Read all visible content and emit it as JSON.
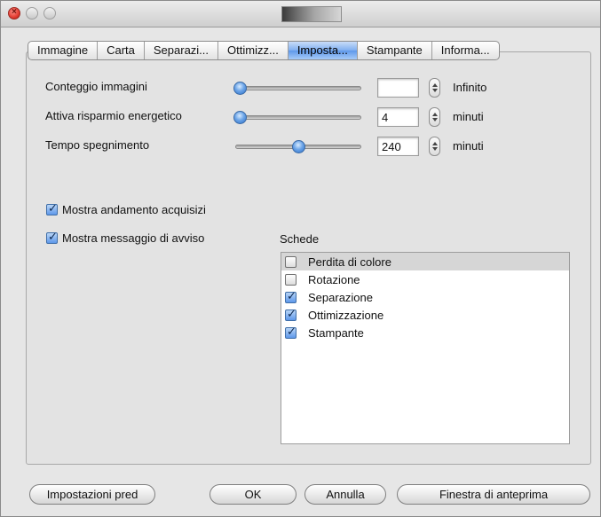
{
  "window": {
    "controls": [
      "close",
      "minimize",
      "zoom"
    ]
  },
  "tabs": [
    {
      "label": "Immagine",
      "selected": false
    },
    {
      "label": "Carta",
      "selected": false
    },
    {
      "label": "Separazi...",
      "selected": false
    },
    {
      "label": "Ottimizz...",
      "selected": false
    },
    {
      "label": "Imposta...",
      "selected": true
    },
    {
      "label": "Stampante",
      "selected": false
    },
    {
      "label": "Informa...",
      "selected": false
    }
  ],
  "settings": {
    "image_count": {
      "label": "Conteggio immagini",
      "slider_fraction": 0.0,
      "value": "",
      "unit": "Infinito"
    },
    "power_saving": {
      "label": "Attiva risparmio energetico",
      "slider_fraction": 0.0,
      "value": "4",
      "unit": "minuti"
    },
    "power_off": {
      "label": "Tempo spegnimento",
      "slider_fraction": 0.5,
      "value": "240",
      "unit": "minuti"
    }
  },
  "checkboxes": {
    "show_progress": {
      "label": "Mostra andamento acquisizi",
      "checked": true
    },
    "show_warning": {
      "label": "Mostra messaggio di avviso",
      "checked": true
    }
  },
  "schede": {
    "label": "Schede",
    "items": [
      {
        "label": "Perdita di colore",
        "checked": false,
        "highlighted": true
      },
      {
        "label": "Rotazione",
        "checked": false,
        "highlighted": false
      },
      {
        "label": "Separazione",
        "checked": true,
        "highlighted": false
      },
      {
        "label": "Ottimizzazione",
        "checked": true,
        "highlighted": false
      },
      {
        "label": "Stampante",
        "checked": true,
        "highlighted": false
      }
    ]
  },
  "buttons": {
    "defaults": "Impostazioni pred",
    "ok": "OK",
    "cancel": "Annulla",
    "preview": "Finestra di anteprima"
  },
  "colors": {
    "accent": "#5e98ea",
    "window_bg": "#e6e6e6",
    "selected_tab": "#7eaef0"
  }
}
